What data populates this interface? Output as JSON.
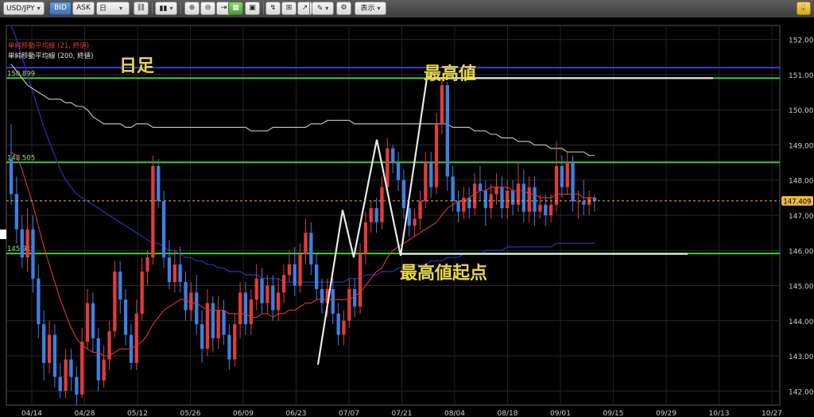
{
  "toolbar": {
    "symbol": "USD/JPY",
    "bid_label": "BID",
    "ask_label": "ASK",
    "timeframe": "日",
    "display_label": "表示"
  },
  "colors": {
    "up_candle": "#e23b3b",
    "down_candle": "#3f7fe0",
    "sma21": "#d83a3a",
    "sma200": "#b9b9b9",
    "blue_ma": "#2d2da8",
    "green_line": "#3ecf2c",
    "current_price": "#f0b840",
    "annotation": "#e8d84a"
  },
  "chart_data": {
    "type": "candlestick",
    "symbol": "USD/JPY",
    "price_side": "BID",
    "timeframe": "日",
    "legend": [
      {
        "label": "単純移動平均線 (21, 終値)",
        "color": "#d83a3a"
      },
      {
        "label": "単純移動平均線 (200, 終値)",
        "color": "#e0e0e0"
      }
    ],
    "y_axis": {
      "min": 141.6,
      "max": 152.4,
      "side": "right",
      "ticks": [
        "152.000",
        "151.000",
        "150.000",
        "149.000",
        "148.000",
        "147.000",
        "146.000",
        "145.000",
        "144.000",
        "143.000",
        "142.000"
      ]
    },
    "x_axis": {
      "ticks": [
        "04/14",
        "04/28",
        "05/12",
        "05/26",
        "06/09",
        "06/23",
        "07/07",
        "07/21",
        "08/04",
        "08/18",
        "09/01",
        "09/15",
        "09/29",
        "10/13",
        "10/27"
      ]
    },
    "current_price": {
      "value": 147.409,
      "label": "147.409"
    },
    "horizontal_lines": [
      {
        "value": 151.2,
        "color": "#3a3ad0",
        "label": ""
      },
      {
        "value": 150.899,
        "color": "#3ecf2c",
        "label": "150.899"
      },
      {
        "value": 148.505,
        "color": "#3ecf2c",
        "label": "148.505"
      },
      {
        "value": 145.912,
        "color": "#3ecf2c",
        "label": "145.912"
      }
    ],
    "annotations": [
      {
        "text": "日足"
      },
      {
        "text": "最高値"
      },
      {
        "text": "最高値起点"
      }
    ],
    "candles": [
      [
        148.6,
        147.6,
        149.6,
        147.3
      ],
      [
        147.6,
        146.6,
        148.1,
        146.2
      ],
      [
        146.6,
        145.8,
        147.0,
        145.5
      ],
      [
        145.8,
        146.6,
        147.2,
        145.4
      ],
      [
        146.6,
        145.2,
        147.0,
        144.8
      ],
      [
        145.2,
        143.9,
        145.6,
        143.5
      ],
      [
        143.9,
        142.8,
        144.3,
        142.3
      ],
      [
        142.8,
        143.6,
        144.0,
        142.5
      ],
      [
        143.6,
        142.4,
        143.9,
        142.1
      ],
      [
        142.4,
        142.0,
        142.8,
        141.8
      ],
      [
        142.0,
        142.9,
        143.2,
        141.8
      ],
      [
        142.9,
        142.4,
        143.2,
        142.0
      ],
      [
        142.4,
        141.9,
        142.7,
        141.6
      ],
      [
        141.9,
        143.4,
        143.8,
        141.8
      ],
      [
        143.4,
        144.5,
        144.9,
        143.2
      ],
      [
        144.5,
        143.5,
        144.8,
        143.1
      ],
      [
        143.5,
        142.3,
        143.8,
        142.0
      ],
      [
        142.3,
        142.9,
        143.3,
        142.1
      ],
      [
        142.9,
        143.7,
        144.0,
        142.6
      ],
      [
        143.7,
        145.4,
        145.7,
        143.5
      ],
      [
        145.4,
        144.6,
        145.7,
        144.2
      ],
      [
        144.6,
        143.6,
        144.9,
        143.3
      ],
      [
        143.6,
        142.8,
        143.9,
        142.6
      ],
      [
        142.8,
        144.2,
        144.6,
        142.6
      ],
      [
        144.2,
        145.4,
        145.8,
        144.0
      ],
      [
        145.4,
        145.8,
        146.0,
        145.0
      ],
      [
        145.8,
        148.4,
        148.7,
        145.6
      ],
      [
        148.4,
        147.4,
        148.6,
        147.2
      ],
      [
        147.4,
        145.8,
        147.7,
        145.5
      ],
      [
        145.8,
        145.1,
        146.3,
        144.9
      ],
      [
        145.1,
        145.6,
        146.0,
        144.8
      ],
      [
        145.6,
        145.1,
        146.1,
        144.8
      ],
      [
        145.1,
        144.3,
        145.4,
        144.0
      ],
      [
        144.3,
        144.8,
        145.1,
        144.0
      ],
      [
        144.8,
        143.9,
        145.3,
        143.6
      ],
      [
        143.9,
        143.2,
        144.3,
        142.8
      ],
      [
        143.2,
        144.5,
        144.9,
        143.0
      ],
      [
        144.5,
        143.5,
        144.7,
        143.1
      ],
      [
        143.5,
        144.3,
        144.7,
        143.2
      ],
      [
        144.3,
        143.6,
        144.6,
        143.3
      ],
      [
        143.6,
        142.9,
        143.9,
        142.6
      ],
      [
        142.9,
        143.9,
        144.2,
        142.7
      ],
      [
        143.9,
        144.8,
        145.1,
        143.5
      ],
      [
        144.8,
        143.9,
        145.1,
        143.6
      ],
      [
        143.9,
        144.6,
        144.9,
        143.6
      ],
      [
        144.6,
        145.2,
        145.6,
        144.3
      ],
      [
        145.2,
        144.5,
        145.5,
        144.2
      ],
      [
        144.5,
        145.0,
        145.3,
        144.2
      ],
      [
        145.0,
        144.3,
        145.3,
        144.0
      ],
      [
        144.3,
        144.8,
        145.2,
        144.0
      ],
      [
        144.8,
        145.3,
        145.6,
        144.5
      ],
      [
        145.3,
        145.6,
        146.0,
        145.1
      ],
      [
        145.6,
        145.0,
        146.1,
        144.7
      ],
      [
        145.0,
        145.9,
        146.2,
        144.8
      ],
      [
        145.9,
        146.5,
        146.9,
        145.6
      ],
      [
        146.5,
        145.6,
        146.8,
        145.3
      ],
      [
        145.6,
        144.9,
        145.9,
        144.6
      ],
      [
        144.9,
        144.5,
        145.2,
        144.2
      ],
      [
        144.5,
        144.9,
        145.2,
        144.1
      ],
      [
        144.9,
        144.2,
        145.2,
        143.9
      ],
      [
        144.2,
        143.6,
        144.5,
        143.3
      ],
      [
        143.6,
        144.0,
        144.3,
        143.3
      ],
      [
        144.0,
        144.9,
        145.2,
        143.8
      ],
      [
        144.9,
        144.4,
        145.2,
        144.1
      ],
      [
        144.4,
        145.9,
        146.2,
        144.2
      ],
      [
        145.9,
        146.8,
        147.1,
        145.6
      ],
      [
        146.8,
        147.2,
        147.4,
        146.5
      ],
      [
        147.2,
        146.8,
        147.5,
        146.5
      ],
      [
        146.8,
        147.8,
        148.1,
        146.6
      ],
      [
        147.8,
        148.9,
        149.2,
        147.6
      ],
      [
        148.9,
        148.5,
        149.0,
        148.2
      ],
      [
        148.5,
        148.0,
        148.8,
        147.7
      ],
      [
        148.0,
        147.2,
        148.3,
        146.9
      ],
      [
        147.2,
        146.7,
        147.5,
        146.4
      ],
      [
        146.7,
        146.9,
        147.2,
        146.4
      ],
      [
        146.9,
        147.4,
        147.7,
        146.6
      ],
      [
        147.4,
        148.5,
        148.8,
        147.2
      ],
      [
        148.5,
        147.8,
        148.8,
        147.5
      ],
      [
        147.8,
        149.6,
        149.9,
        147.6
      ],
      [
        149.6,
        150.7,
        150.9,
        149.3
      ],
      [
        150.7,
        148.1,
        150.8,
        147.7
      ],
      [
        148.1,
        147.4,
        148.4,
        147.1
      ],
      [
        147.4,
        147.1,
        147.7,
        146.8
      ],
      [
        147.1,
        147.5,
        147.8,
        146.9
      ],
      [
        147.5,
        147.2,
        147.8,
        146.9
      ],
      [
        147.2,
        147.9,
        148.2,
        147.0
      ],
      [
        147.9,
        147.7,
        148.4,
        147.4
      ],
      [
        147.7,
        147.2,
        148.0,
        146.7
      ],
      [
        147.2,
        147.6,
        147.9,
        146.9
      ],
      [
        147.6,
        147.8,
        148.2,
        147.3
      ],
      [
        147.8,
        147.2,
        148.1,
        146.9
      ],
      [
        147.2,
        147.7,
        148.0,
        146.9
      ],
      [
        147.7,
        147.3,
        148.0,
        147.0
      ],
      [
        147.3,
        147.9,
        148.5,
        147.1
      ],
      [
        147.9,
        147.1,
        148.3,
        146.8
      ],
      [
        147.1,
        147.8,
        148.1,
        146.8
      ],
      [
        147.8,
        147.1,
        148.1,
        146.7
      ],
      [
        147.1,
        147.3,
        147.6,
        146.9
      ],
      [
        147.3,
        147.0,
        147.6,
        146.7
      ],
      [
        147.0,
        147.3,
        147.6,
        146.8
      ],
      [
        147.3,
        148.4,
        149.1,
        147.1
      ],
      [
        148.4,
        147.8,
        148.7,
        147.5
      ],
      [
        147.8,
        148.5,
        148.8,
        147.6
      ],
      [
        148.5,
        147.4,
        148.7,
        147.1
      ],
      [
        147.4,
        147.4,
        147.7,
        146.9
      ],
      [
        147.4,
        147.3,
        148.0,
        147.0
      ],
      [
        147.3,
        147.5,
        147.7,
        147.0
      ],
      [
        147.5,
        147.4,
        147.6,
        147.1
      ]
    ],
    "sma21": [
      148.8,
      148.7,
      148.3,
      147.8,
      147.3,
      146.7,
      146.1,
      145.6,
      145.1,
      144.6,
      144.2,
      143.8,
      143.5,
      143.3,
      143.2,
      143.1,
      143.1,
      143.0,
      143.0,
      143.1,
      143.2,
      143.2,
      143.2,
      143.3,
      143.4,
      143.6,
      143.9,
      144.1,
      144.3,
      144.4,
      144.5,
      144.6,
      144.6,
      144.5,
      144.5,
      144.4,
      144.3,
      144.3,
      144.3,
      144.3,
      144.2,
      144.2,
      144.2,
      144.2,
      144.1,
      144.1,
      144.2,
      144.2,
      144.1,
      144.2,
      144.2,
      144.3,
      144.3,
      144.4,
      144.5,
      144.5,
      144.6,
      144.6,
      144.6,
      144.6,
      144.6,
      144.6,
      144.6,
      144.7,
      144.8,
      145.0,
      145.2,
      145.4,
      145.5,
      145.8,
      146.0,
      146.1,
      146.2,
      146.3,
      146.4,
      146.5,
      146.6,
      146.7,
      146.8,
      147.0,
      147.2,
      147.3,
      147.4,
      147.4,
      147.5,
      147.6,
      147.7,
      147.7,
      147.8,
      147.8,
      147.8,
      147.8,
      147.7,
      147.7,
      147.7,
      147.6,
      147.6,
      147.5,
      147.5,
      147.5,
      147.6,
      147.6,
      147.6,
      147.6,
      147.6,
      147.5,
      147.5,
      147.5
    ],
    "sma200": [
      151.3,
      151.1,
      150.9,
      150.7,
      150.6,
      150.5,
      150.4,
      150.3,
      150.3,
      150.3,
      150.2,
      150.2,
      150.1,
      150.1,
      150.0,
      149.8,
      149.7,
      149.6,
      149.6,
      149.6,
      149.6,
      149.5,
      149.5,
      149.6,
      149.6,
      149.6,
      149.5,
      149.5,
      149.5,
      149.5,
      149.5,
      149.5,
      149.5,
      149.5,
      149.5,
      149.5,
      149.5,
      149.5,
      149.5,
      149.5,
      149.5,
      149.5,
      149.5,
      149.5,
      149.4,
      149.4,
      149.4,
      149.4,
      149.5,
      149.5,
      149.5,
      149.5,
      149.5,
      149.5,
      149.5,
      149.6,
      149.6,
      149.6,
      149.7,
      149.7,
      149.7,
      149.7,
      149.7,
      149.6,
      149.6,
      149.6,
      149.6,
      149.6,
      149.6,
      149.6,
      149.6,
      149.6,
      149.6,
      149.6,
      149.6,
      149.6,
      149.6,
      149.6,
      149.6,
      149.6,
      149.6,
      149.5,
      149.5,
      149.5,
      149.5,
      149.4,
      149.4,
      149.4,
      149.3,
      149.3,
      149.2,
      149.2,
      149.2,
      149.1,
      149.1,
      149.1,
      149.0,
      149.0,
      149.0,
      148.9,
      148.9,
      148.9,
      148.8,
      148.8,
      148.8,
      148.8,
      148.7,
      148.7
    ],
    "blue_ma": [
      152.4,
      152.0,
      151.5,
      151.0,
      150.5,
      150.0,
      149.5,
      149.1,
      148.7,
      148.3,
      148.0,
      147.8,
      147.6,
      147.5,
      147.4,
      147.3,
      147.2,
      147.1,
      147.0,
      146.9,
      146.8,
      146.7,
      146.6,
      146.5,
      146.4,
      146.3,
      146.2,
      146.2,
      146.1,
      146.0,
      146.0,
      145.9,
      145.8,
      145.8,
      145.7,
      145.7,
      145.6,
      145.6,
      145.5,
      145.5,
      145.4,
      145.4,
      145.4,
      145.3,
      145.3,
      145.3,
      145.2,
      145.2,
      145.2,
      145.2,
      145.1,
      145.1,
      145.1,
      145.1,
      145.1,
      145.1,
      145.1,
      145.1,
      145.1,
      145.1,
      145.1,
      145.1,
      145.2,
      145.2,
      145.2,
      145.3,
      145.3,
      145.3,
      145.4,
      145.4,
      145.4,
      145.5,
      145.5,
      145.5,
      145.6,
      145.6,
      145.6,
      145.7,
      145.7,
      145.7,
      145.8,
      145.8,
      145.8,
      145.9,
      145.9,
      145.9,
      145.9,
      146.0,
      146.0,
      146.0,
      146.0,
      146.1,
      146.1,
      146.1,
      146.1,
      146.1,
      146.1,
      146.1,
      146.1,
      146.1,
      146.2,
      146.2,
      146.2,
      146.2,
      146.2,
      146.2,
      146.2,
      146.2
    ]
  }
}
